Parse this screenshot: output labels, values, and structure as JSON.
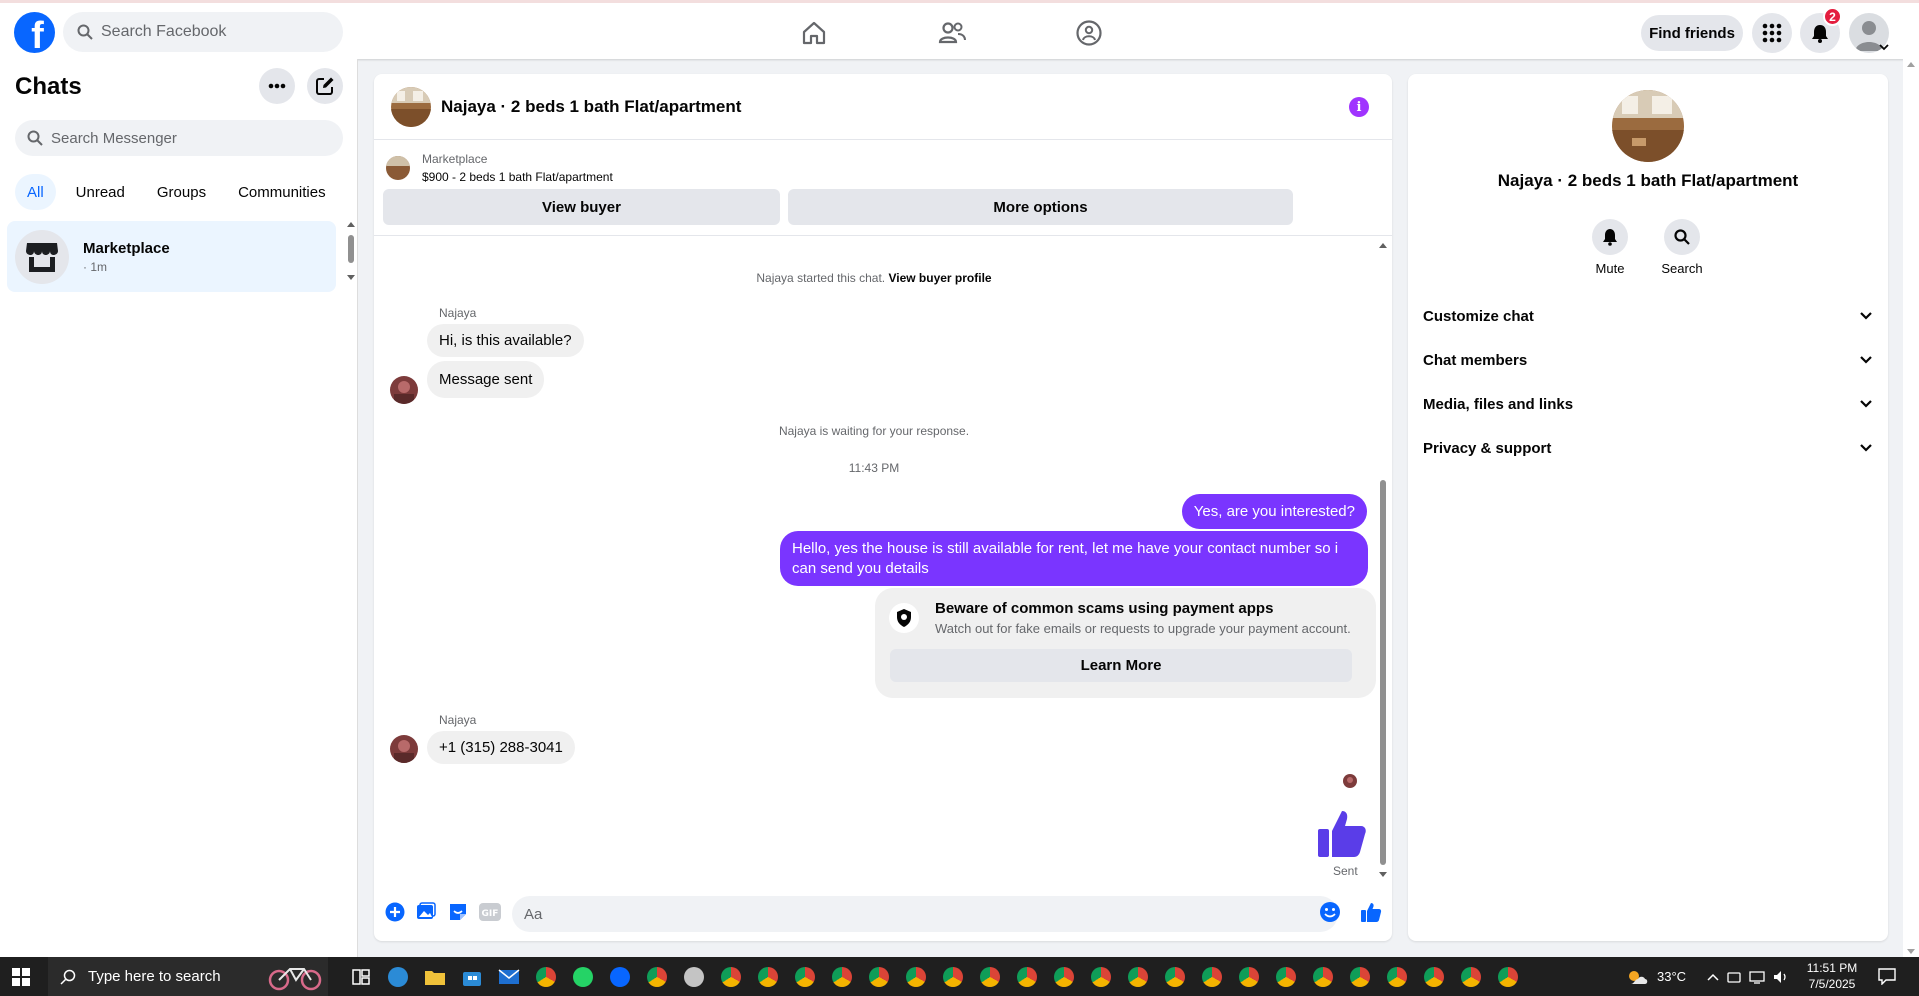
{
  "topnav": {
    "search_placeholder": "Search Facebook",
    "find_friends": "Find friends",
    "notification_count": "2"
  },
  "left": {
    "title": "Chats",
    "search_placeholder": "Search Messenger",
    "filters": [
      "All",
      "Unread",
      "Groups",
      "Communities"
    ],
    "chat": {
      "name": "Marketplace",
      "time": "· 1m"
    }
  },
  "conversation": {
    "title": "Najaya · 2 beds 1 bath Flat/apartment",
    "marketplace_label": "Marketplace",
    "listing": "$900 - 2 beds 1 bath Flat/apartment",
    "view_buyer": "View buyer",
    "more_options": "More options",
    "started_text": "Najaya started this chat.",
    "view_buyer_profile": "View buyer profile",
    "sender_name": "Najaya",
    "msg_in_1": "Hi, is this available?",
    "msg_in_2": "Message sent",
    "waiting_text": "Najaya is waiting for your response.",
    "time_label": "11:43 PM",
    "msg_out_1": "Yes, are you interested?",
    "msg_out_2": "Hello, yes the house is still available for rent, let me have your contact number so i can send you details",
    "scam_title": "Beware of common scams using payment apps",
    "scam_sub": "Watch out for fake emails or requests to upgrade your payment account.",
    "learn_more": "Learn More",
    "sender_name_2": "Najaya",
    "msg_in_3": "+1 (315) 288-3041",
    "sent_label": "Sent",
    "composer_placeholder": "Aa"
  },
  "right": {
    "name": "Najaya · 2 beds 1 bath Flat/apartment",
    "mute": "Mute",
    "search": "Search",
    "sections": [
      "Customize chat",
      "Chat members",
      "Media, files and links",
      "Privacy & support"
    ]
  },
  "taskbar": {
    "search_placeholder": "Type here to search",
    "temperature": "33°C",
    "time": "11:51 PM",
    "date": "7/5/2025"
  },
  "colors": {
    "brand": "#0866ff",
    "outgoing_bubble": "#7a35ff",
    "info_icon": "#a033ff",
    "badge": "#e41e3f"
  }
}
